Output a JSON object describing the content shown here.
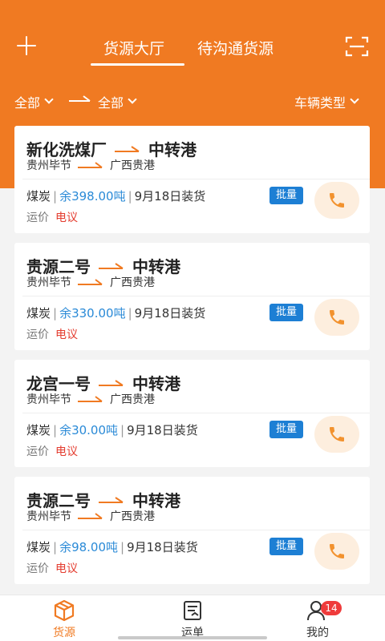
{
  "header": {
    "tabs": [
      {
        "label": "货源大厅",
        "active": true
      },
      {
        "label": "待沟通货源",
        "active": false
      }
    ],
    "plus_icon": "plus-icon",
    "scan_icon": "scan-icon",
    "accent_color": "#f07a22"
  },
  "filters": {
    "origin": "全部",
    "destination": "全部",
    "vehicle_type": "车辆类型"
  },
  "cards": [
    {
      "from_name": "新化洗煤厂",
      "to_name": "中转港",
      "from_region": "贵州毕节",
      "to_region": "广西贵港",
      "cargo": "煤炭",
      "remaining": "余398.00吨",
      "loading_date": "9月18日装货",
      "price_label": "运价",
      "price_value": "电议",
      "badge": "批量"
    },
    {
      "from_name": "贵源二号",
      "to_name": "中转港",
      "from_region": "贵州毕节",
      "to_region": "广西贵港",
      "cargo": "煤炭",
      "remaining": "余330.00吨",
      "loading_date": "9月18日装货",
      "price_label": "运价",
      "price_value": "电议",
      "badge": "批量"
    },
    {
      "from_name": "龙宫一号",
      "to_name": "中转港",
      "from_region": "贵州毕节",
      "to_region": "广西贵港",
      "cargo": "煤炭",
      "remaining": "余30.00吨",
      "loading_date": "9月18日装货",
      "price_label": "运价",
      "price_value": "电议",
      "badge": "批量"
    },
    {
      "from_name": "贵源二号",
      "to_name": "中转港",
      "from_region": "贵州毕节",
      "to_region": "广西贵港",
      "cargo": "煤炭",
      "remaining": "余98.00吨",
      "loading_date": "9月18日装货",
      "price_label": "运价",
      "price_value": "电议",
      "badge": "批量"
    }
  ],
  "bottom_nav": {
    "items": [
      {
        "label": "货源",
        "icon": "box-icon",
        "active": true
      },
      {
        "label": "运单",
        "icon": "waybill-icon",
        "active": false
      },
      {
        "label": "我的",
        "icon": "user-icon",
        "active": false,
        "badge": "14"
      }
    ]
  }
}
